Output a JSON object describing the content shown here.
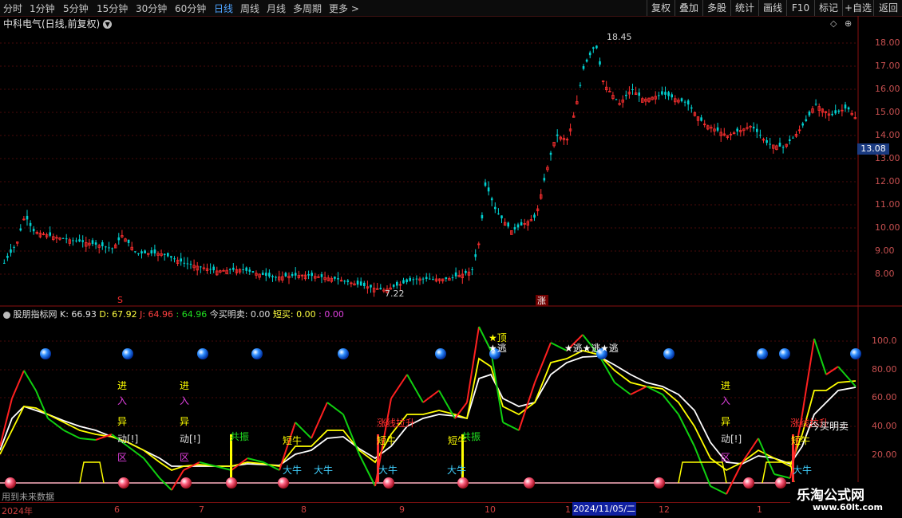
{
  "toolbar": {
    "periods": [
      "分时",
      "1分钟",
      "5分钟",
      "15分钟",
      "30分钟",
      "60分钟",
      "日线",
      "周线",
      "月线",
      "多周期",
      "更多 >"
    ],
    "active_period": "日线",
    "actions": [
      "复权",
      "叠加",
      "多股",
      "统计",
      "画线",
      "F10",
      "标记",
      "+自选",
      "返回"
    ]
  },
  "stock": {
    "title": "中科电气(日线,前复权)",
    "high_marker": "18.45",
    "low_marker": "7.22",
    "current_price": "13.08"
  },
  "price_axis": [
    "18.00",
    "17.00",
    "16.00",
    "15.00",
    "14.00",
    "13.00",
    "12.00",
    "11.00",
    "10.00",
    "9.00",
    "8.00"
  ],
  "markers": {
    "s_marker": "S",
    "zhang_marker": "涨"
  },
  "indicator": {
    "name": "股朋指标网",
    "k_label": "K: 66.93",
    "d_label": "D: 67.92",
    "j_label": "J: 64.96",
    "extra_label": ": 64.96",
    "buy_today": "今买明卖: 0.00",
    "short_buy": "短买: 0.00",
    "last_val": ": 0.00",
    "axis": [
      "100.0",
      "80.00",
      "60.00",
      "40.00",
      "20.00"
    ]
  },
  "annotations": {
    "jin": "进",
    "ru": "入",
    "yi": "异",
    "dong": "动[!]",
    "qu": "区",
    "gongzhen": "共振",
    "duanniu": "短牛",
    "daniu": "大牛",
    "zhangxian": "涨线拉升",
    "top": "★顶",
    "tao": "★逃",
    "taotao": "★逃★逃",
    "jinmai": "今买明卖"
  },
  "dates": [
    "2024年",
    "6",
    "7",
    "8",
    "9",
    "10",
    "1",
    "12",
    "1"
  ],
  "date_highlight": "2024/11/05/二",
  "note": "用到未来数据",
  "watermark": {
    "title": "乐淘公式网",
    "url": "www.60lt.com"
  },
  "colors": {
    "up": "#ff3030",
    "down": "#00d0d0",
    "k": "#ffffff",
    "d": "#ffff00",
    "j_up": "#ff2020",
    "j_down": "#10d010"
  }
}
